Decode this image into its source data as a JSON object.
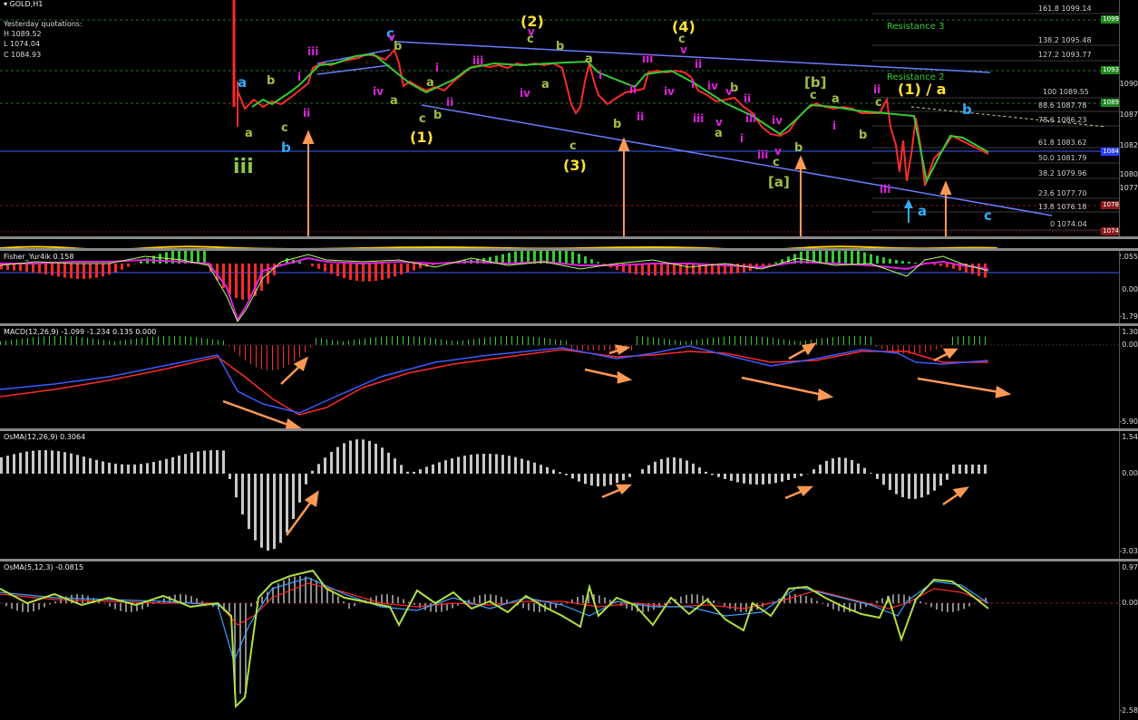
{
  "chart_title": "GOLD,H1",
  "quotes": {
    "label": "Yesterday quotations:",
    "high": "H 1089.52",
    "low": "L 1074.04",
    "close": "C 1084.93"
  },
  "resistance_labels": [
    "Resistance 3",
    "Resistance 2"
  ],
  "fib_levels": [
    "161.8 1099.14",
    "138.2 1095.48",
    "127.2 1093.77",
    "100 1089.55",
    "88.6 1087.78",
    "78.6 1086.23",
    "61.8 1083.62",
    "50.0 1081.79",
    "38.2 1079.96",
    "23.6 1077.70",
    "13.8 1076.18",
    "0 1074.04"
  ],
  "price_axis": [
    "1090",
    "1087",
    "1082",
    "1080",
    "1077"
  ],
  "price_boxes": [
    "1099",
    "1093",
    "1089",
    "1084",
    "1078",
    "1074"
  ],
  "wave_labels": {
    "w1": "(1)",
    "w2": "(2)",
    "w3": "(3)",
    "w4": "(4)",
    "w1a": "(1) / a",
    "a": "a",
    "b": "b",
    "c": "c",
    "i": "i",
    "ii": "ii",
    "iii": "iii",
    "iv": "iv",
    "v": "v",
    "big_iii": "iii",
    "bb": "[b]",
    "ba": "[a]"
  },
  "fisher": {
    "title": "Fisher_Yur4ik 0.158",
    "axis": [
      "2.055",
      "0.00",
      "-1.79"
    ]
  },
  "macd": {
    "title": "MACD(12,26,9) -1.099 -1.234 0.135 0.000",
    "axis": [
      "1.30",
      "0.00",
      "-5.90"
    ]
  },
  "osma1": {
    "title": "OsMA(12,26,9) 0.3064",
    "axis": [
      "1.54",
      "0.00",
      "-3.03"
    ]
  },
  "osma2": {
    "title": "OsMA(5,12,3) -0.0815",
    "axis": [
      "0.97",
      "0.00",
      "-2.58"
    ]
  },
  "colors": {
    "bull": "#33cc33",
    "bear": "#ff2a2a",
    "channel": "#6a7dff",
    "arrow": "#ff9955",
    "yellow": "#ffe033",
    "magenta": "#e020e0",
    "cyan": "#33aaff",
    "olive": "#a0c040",
    "green_label": "#88cc66"
  }
}
